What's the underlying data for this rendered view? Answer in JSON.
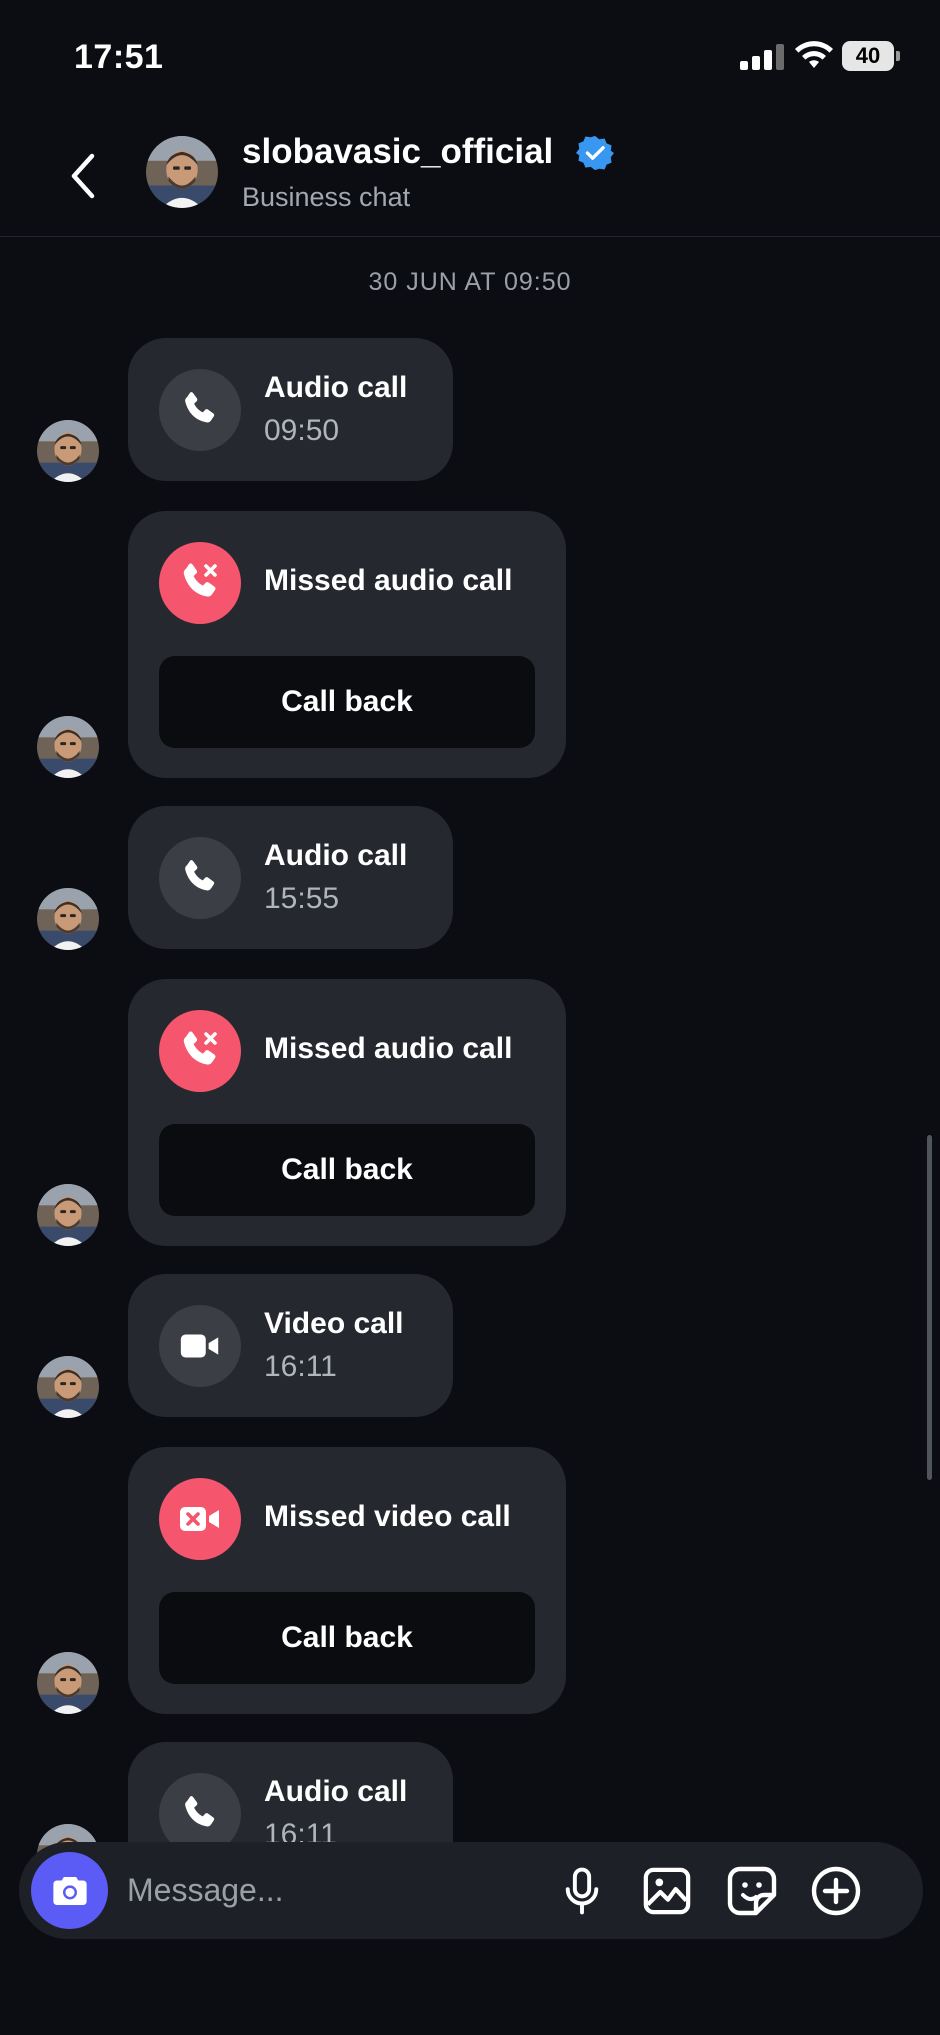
{
  "status_bar": {
    "time": "17:51",
    "battery": "40"
  },
  "header": {
    "name": "slobavasic_official",
    "subtitle": "Business chat"
  },
  "date_separator": "30 JUN AT 09:50",
  "messages": [
    {
      "title": "Audio call",
      "time": "09:50",
      "icon": "phone-icon"
    },
    {
      "title": "Missed audio call",
      "action": "Call back",
      "icon": "missed-call-icon"
    },
    {
      "title": "Audio call",
      "time": "15:55",
      "icon": "phone-icon"
    },
    {
      "title": "Missed audio call",
      "action": "Call back",
      "icon": "missed-call-icon"
    },
    {
      "title": "Video call",
      "time": "16:11",
      "icon": "video-camera-icon"
    },
    {
      "title": "Missed video call",
      "action": "Call back",
      "icon": "missed-video-icon"
    },
    {
      "title": "Audio call",
      "time": "16:11",
      "icon": "phone-icon"
    }
  ],
  "composer": {
    "placeholder": "Message..."
  },
  "colors": {
    "background": "#0b0d12",
    "bubble": "#25282f",
    "missed": "#f5566e",
    "camera": "#5b5bf6",
    "verified": "#3897f0"
  }
}
